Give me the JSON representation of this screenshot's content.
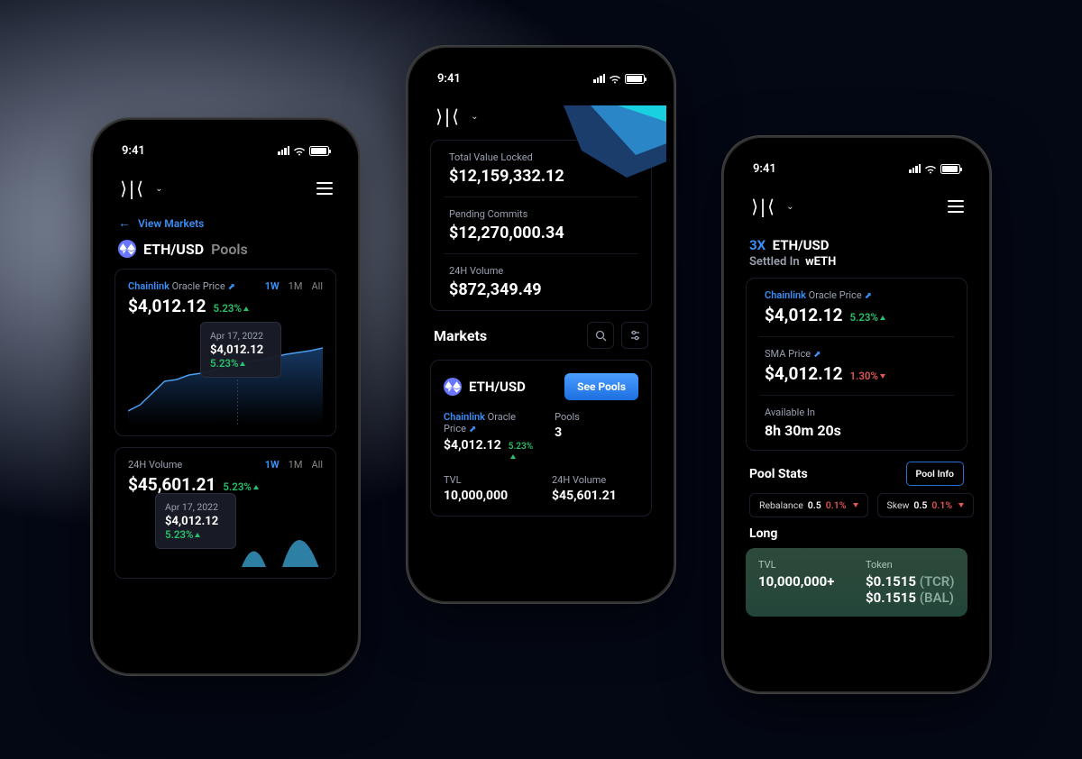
{
  "statusbar": {
    "time": "9:41"
  },
  "phone1": {
    "back": "View Markets",
    "pair": "ETH/USD",
    "pools": "Pools",
    "oracle_provider": "Chainlink",
    "oracle_label": "Oracle Price",
    "price": "$4,012.12",
    "pct": "5.23%",
    "ranges": [
      "1W",
      "1M",
      "All"
    ],
    "tooltip": {
      "date": "Apr 17, 2022",
      "price": "$4,012.12",
      "pct": "5.23%"
    },
    "vol_label": "24H Volume",
    "vol": "$45,601.21",
    "vol_pct": "5.23%",
    "tooltip2": {
      "date": "Apr 17, 2022",
      "price": "$4,012.12",
      "pct": "5.23%"
    }
  },
  "phone2": {
    "tvl_label": "Total Value Locked",
    "tvl": "$12,159,332.12",
    "pc_label": "Pending Commits",
    "pc": "$12,270,000.34",
    "vol_label": "24H Volume",
    "vol": "$872,349.49",
    "markets_title": "Markets",
    "market": {
      "pair": "ETH/USD",
      "see_pools": "See Pools",
      "oracle_provider": "Chainlink",
      "oracle_label": "Oracle Price",
      "price": "$4,012.12",
      "pct": "5.23%",
      "pools_label": "Pools",
      "pools": "3",
      "tvl_label": "TVL",
      "tvl": "10,000,000",
      "vol_label": "24H Volume",
      "vol": "$45,601.21"
    }
  },
  "phone3": {
    "lev": "3X",
    "pair": "ETH/USD",
    "settled_label": "Settled In",
    "settled": "wETH",
    "oracle_provider": "Chainlink",
    "oracle_label": "Oracle Price",
    "price": "$4,012.12",
    "pct": "5.23%",
    "sma_label": "SMA Price",
    "sma_price": "$4,012.12",
    "sma_pct": "1.30%",
    "avail_label": "Available In",
    "avail": "8h 30m 20s",
    "poolstats": "Pool Stats",
    "poolinfo": "Pool Info",
    "rebalance_label": "Rebalance",
    "rebalance_v1": "0.5",
    "rebalance_v2": "0.1%",
    "skew_label": "Skew",
    "skew_v1": "0.5",
    "skew_v2": "0.1%",
    "long": "Long",
    "long_tvl_label": "TVL",
    "long_tvl": "10,000,000+",
    "token_label": "Token",
    "token1_price": "$0.1515",
    "token1_sym": "(TCR)",
    "token2_price": "$0.1515",
    "token2_sym": "(BAL)"
  },
  "chart_data": {
    "type": "line",
    "title": "ETH/USD Oracle Price",
    "x_range": "1W",
    "ylim": [
      2600,
      4200
    ],
    "points": [
      2700,
      2850,
      3100,
      3350,
      3400,
      3500,
      3550,
      3620,
      3700,
      3780,
      3820,
      3860,
      3900,
      3940,
      3970,
      3990,
      4012
    ],
    "tooltip_index": 9,
    "tooltip": {
      "date": "Apr 17, 2022",
      "value": 4012.12,
      "pct": 5.23
    }
  }
}
